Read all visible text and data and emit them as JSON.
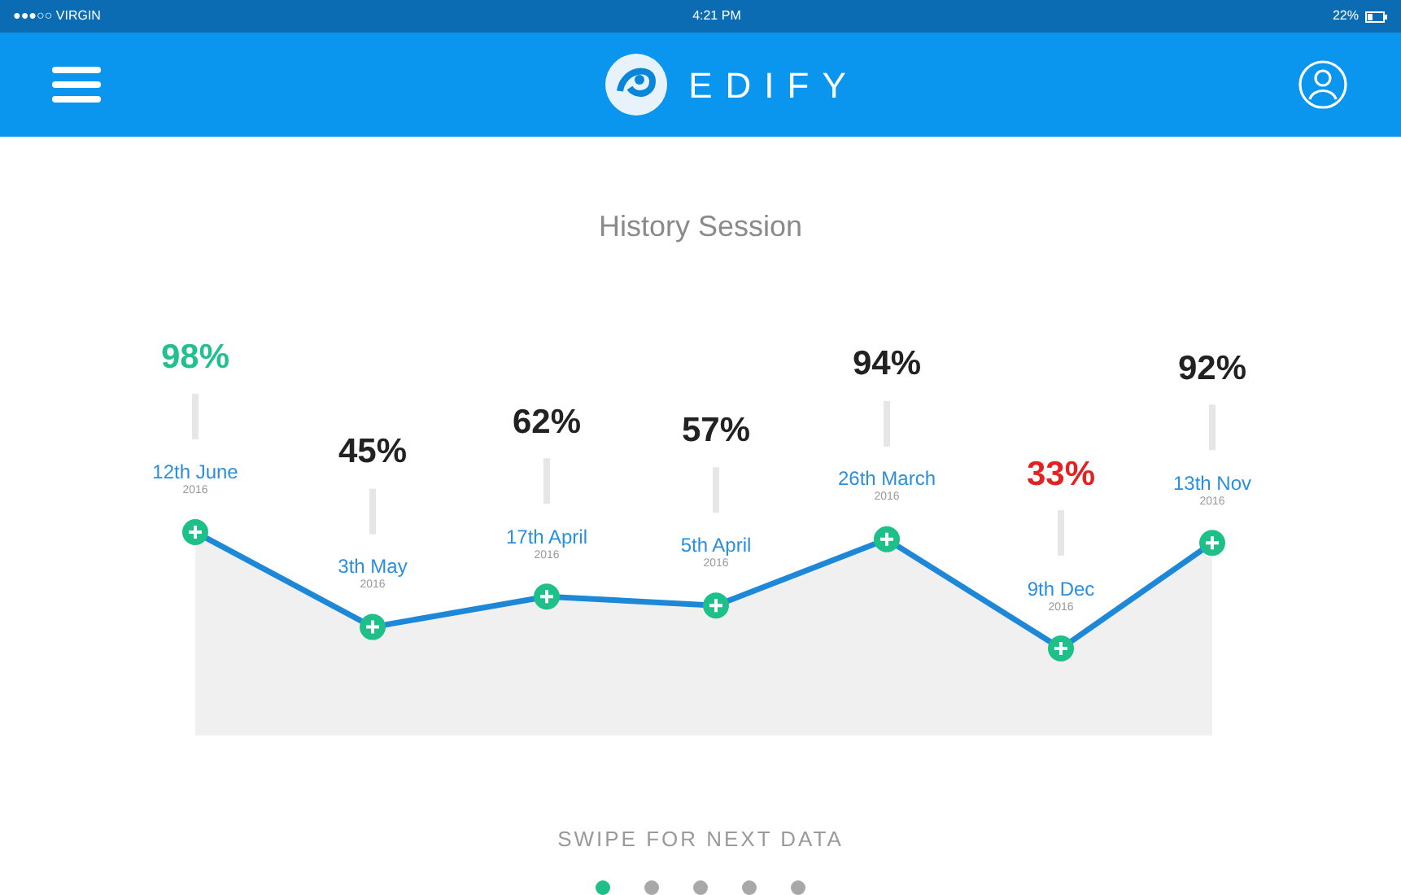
{
  "status_bar": {
    "carrier": "●●●○○ VIRGIN",
    "time": "4:21 PM",
    "battery": "22%"
  },
  "header": {
    "logo_text": "EDIFY"
  },
  "title": "History Session",
  "points": [
    {
      "score": "98%",
      "date": "12th June",
      "year": "2016",
      "color": "#22c08e"
    },
    {
      "score": "45%",
      "date": "3th May",
      "year": "2016",
      "color": "#222222"
    },
    {
      "score": "62%",
      "date": "17th April",
      "year": "2016",
      "color": "#222222"
    },
    {
      "score": "57%",
      "date": "5th April",
      "year": "2016",
      "color": "#222222"
    },
    {
      "score": "94%",
      "date": "26th March",
      "year": "2016",
      "color": "#222222"
    },
    {
      "score": "33%",
      "date": "9th Dec",
      "year": "2016",
      "color": "#e02424"
    },
    {
      "score": "92%",
      "date": "13th Nov",
      "year": "2016",
      "color": "#222222"
    }
  ],
  "hint": "SWIPE FOR NEXT DATA",
  "pages": [
    {
      "selected": true
    },
    {
      "selected": false
    },
    {
      "selected": false
    },
    {
      "selected": false
    },
    {
      "selected": false
    }
  ]
}
